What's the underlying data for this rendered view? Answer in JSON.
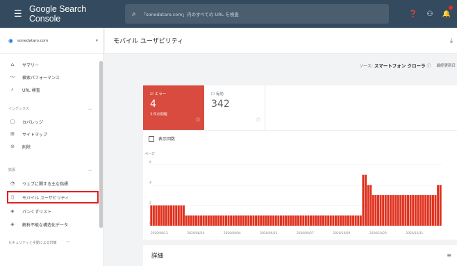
{
  "topbar": {
    "brand": "Google Search Console",
    "search_placeholder": "「sonedataro.com」内のすべての URL を検査",
    "icons": [
      "help-icon",
      "account-icon",
      "notifications-icon"
    ]
  },
  "sidebar": {
    "property": "sonedataro.com",
    "items": [
      {
        "icon": "⌂",
        "label": "サマリー"
      },
      {
        "icon": "〜",
        "label": "検索パフォーマンス"
      },
      {
        "icon": "⌕",
        "label": "URL 検査"
      }
    ],
    "index_section": "インデックス",
    "index_items": [
      {
        "icon": "▢",
        "label": "カバレッジ"
      },
      {
        "icon": "⊞",
        "label": "サイトマップ"
      },
      {
        "icon": "⊘",
        "label": "削除"
      }
    ],
    "enh_section": "拡張",
    "enh_items": [
      {
        "icon": "◔",
        "label": "ウェブに関する主な指標"
      },
      {
        "icon": "▯",
        "label": "モバイル ユーザビリティ"
      },
      {
        "icon": "◈",
        "label": "パンくずリスト"
      },
      {
        "icon": "◈",
        "label": "解析不能な構造化データ"
      }
    ],
    "security_section": "セキュリティと手動による対策"
  },
  "main": {
    "title": "モバイル ユーザビリティ",
    "source_label": "ソース:",
    "source_value": "スマートフォン クローラ",
    "last_updated": "最終更新日",
    "error_label": "エラー",
    "error_count": "4",
    "error_sub": "3 件の問題",
    "valid_label": "有効",
    "valid_count": "342",
    "impressions_label": "表示回数",
    "details_title": "詳細"
  },
  "chart_data": {
    "type": "bar",
    "ylabel": "ページ",
    "yticks": [
      "0",
      "2",
      "4",
      "6"
    ],
    "ylim": [
      0,
      6
    ],
    "xticks": [
      "2020/08/13",
      "2020/08/24",
      "2020/09/04",
      "2020/09/15",
      "2020/09/27",
      "2020/10/09",
      "2020/10/20",
      "2020/10/31"
    ],
    "values": [
      2,
      2,
      2,
      2,
      2,
      2,
      2,
      2,
      2,
      2,
      2,
      2,
      2,
      2,
      1,
      1,
      1,
      1,
      1,
      1,
      1,
      1,
      1,
      1,
      1,
      1,
      1,
      1,
      1,
      1,
      1,
      1,
      1,
      1,
      1,
      1,
      1,
      1,
      1,
      1,
      1,
      1,
      1,
      1,
      1,
      1,
      1,
      1,
      1,
      1,
      1,
      1,
      1,
      1,
      1,
      1,
      1,
      1,
      1,
      1,
      1,
      1,
      1,
      1,
      1,
      1,
      1,
      1,
      1,
      1,
      1,
      1,
      1,
      1,
      1,
      1,
      1,
      1,
      1,
      1,
      1,
      1,
      1,
      1,
      1,
      5,
      5,
      4,
      4,
      3,
      3,
      3,
      3,
      3,
      3,
      3,
      3,
      3,
      3,
      3,
      3,
      3,
      3,
      3,
      3,
      3,
      3,
      3,
      3,
      3,
      3,
      3,
      3,
      3,
      3,
      4,
      4
    ],
    "color": "#e0321f"
  },
  "colors": {
    "topbar": "#344a5e",
    "error": "#d84b3e",
    "highlight": "#e02020"
  }
}
